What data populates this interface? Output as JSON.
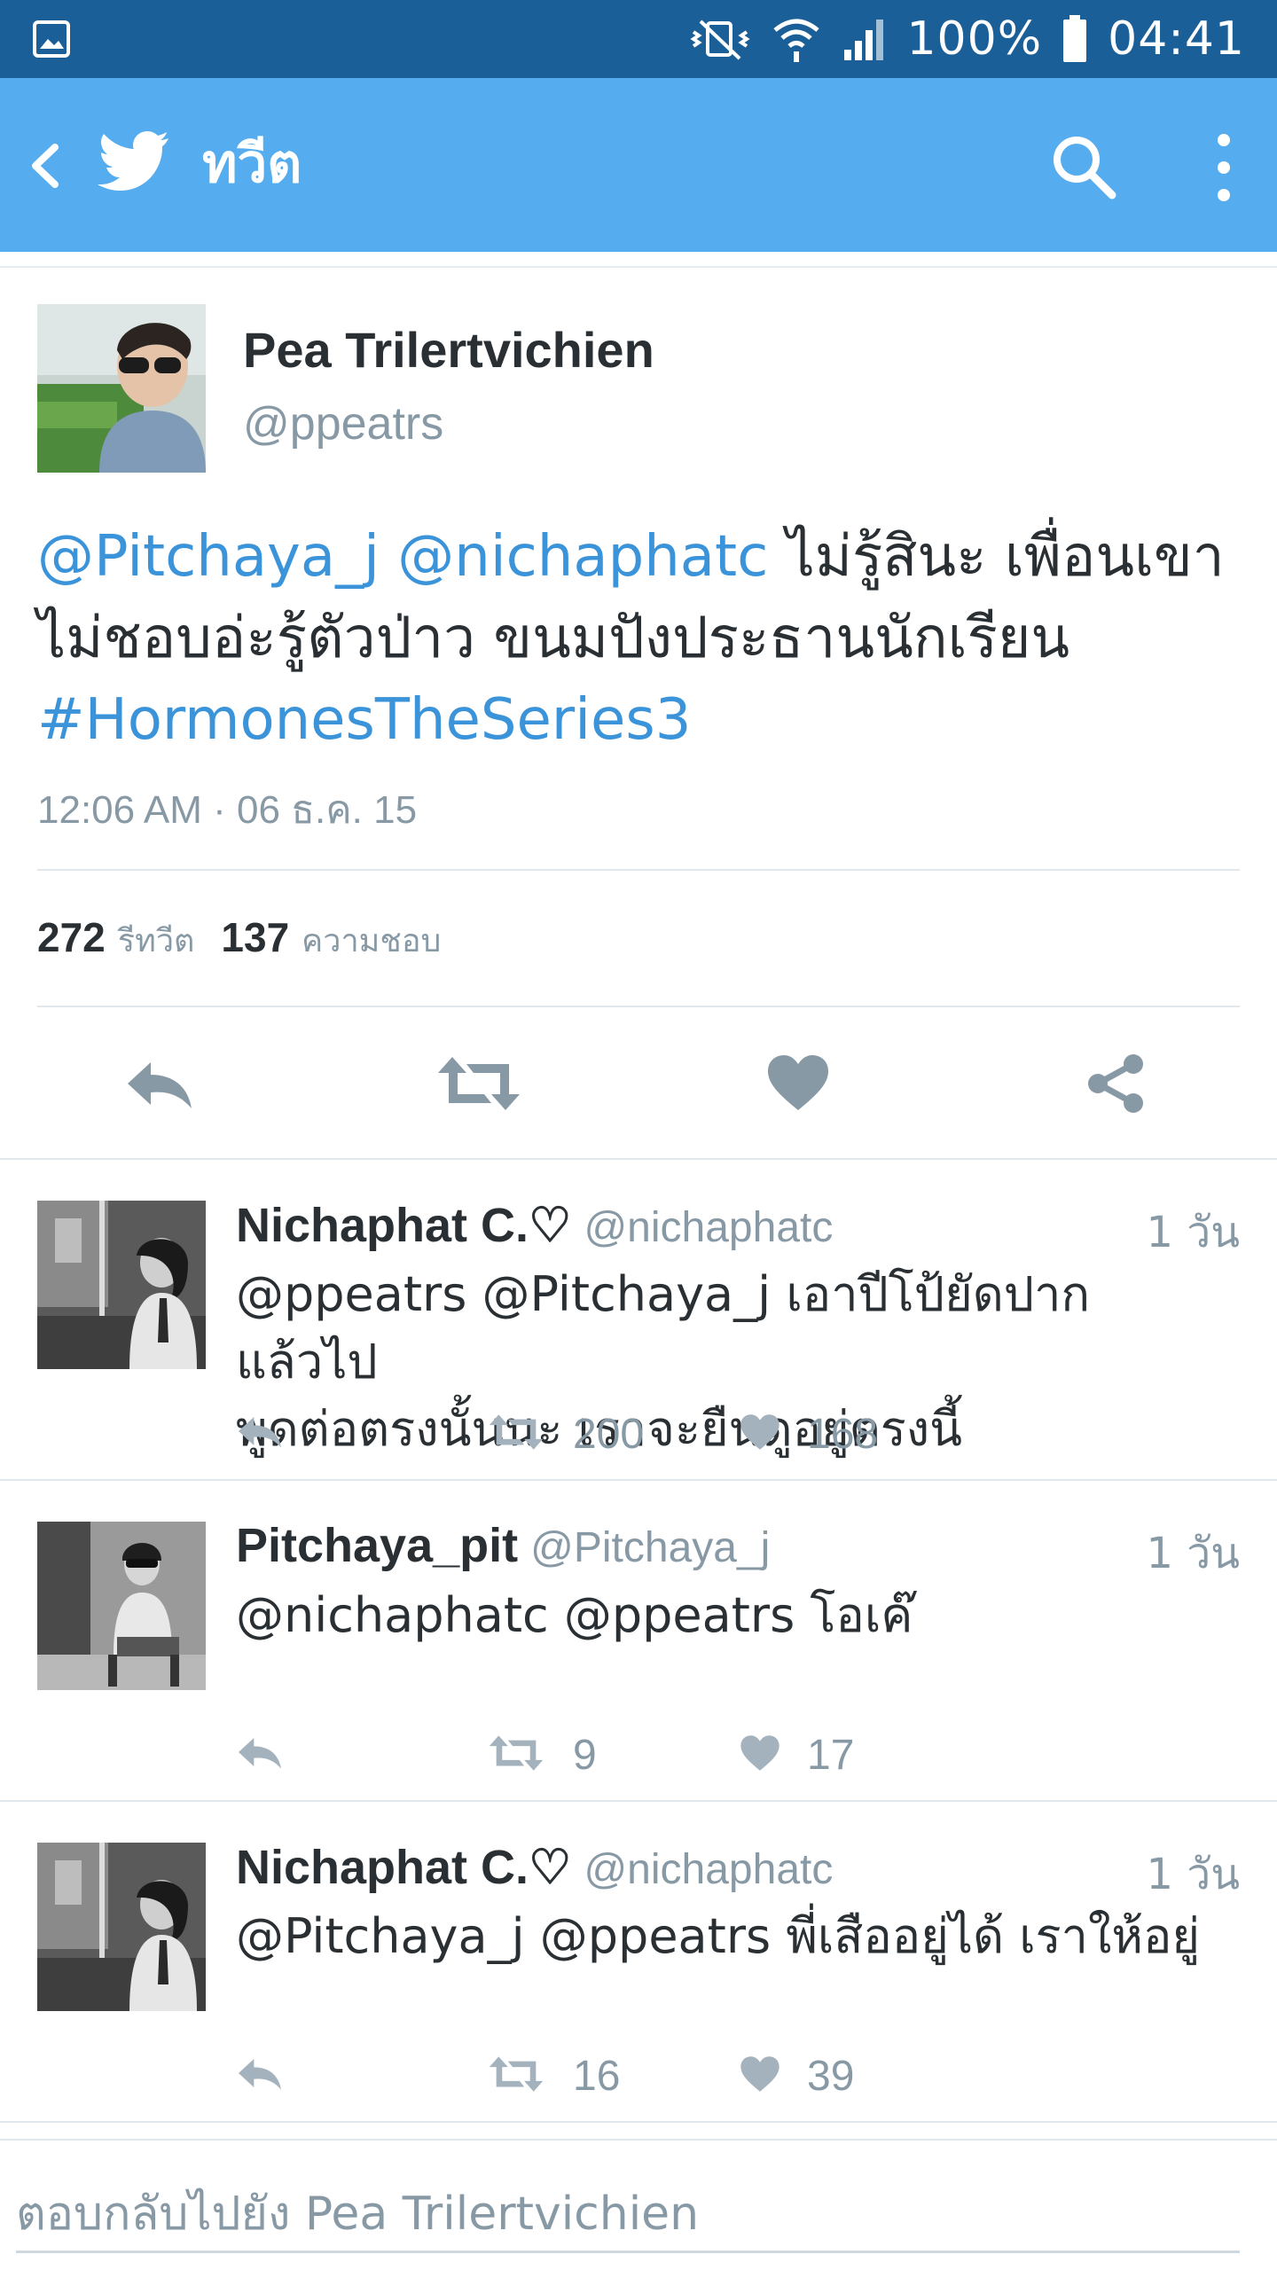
{
  "status_bar": {
    "battery": "100%",
    "time": "04:41"
  },
  "app_bar": {
    "title": "ทวีต"
  },
  "tweet": {
    "author_name": "Pea Trilertvichien",
    "author_handle": "@ppeatrs",
    "mention1": "@Pitchaya_j",
    "mention2": "@nichaphatc",
    "text1": "ไม่รู้สินะ เพื่อนเขา",
    "text2": "ไม่ชอบอ่ะรู้ตัวป่าว ขนมปังประธานนักเรียน",
    "hashtag": "#HormonesTheSeries3",
    "timestamp": "12:06 AM · 06 ธ.ค. 15",
    "retweet_count": "272",
    "retweet_label": "รีทวีต",
    "like_count": "137",
    "like_label": "ความชอบ"
  },
  "replies": [
    {
      "name": "Nichaphat C.♡",
      "handle": "@nichaphatc",
      "time": "1 วัน",
      "line1": "@ppeatrs @Pitchaya_j เอาปีโป้ยัดปาก แล้วไป",
      "line2": "พูดต่อตรงนั้นนะ เราจะยืนดูอยู่ตรงนี้",
      "retweets": "200",
      "likes": "168"
    },
    {
      "name": "Pitchaya_pit",
      "handle": "@Pitchaya_j",
      "time": "1 วัน",
      "line1": "@nichaphatc @ppeatrs โอเค๊",
      "line2": "",
      "retweets": "9",
      "likes": "17"
    },
    {
      "name": "Nichaphat C.♡",
      "handle": "@nichaphatc",
      "time": "1 วัน",
      "line1": "@Pitchaya_j @ppeatrs พี่เสืออยู่ได้ เราให้อยู่",
      "line2": "",
      "retweets": "16",
      "likes": "39"
    }
  ],
  "reply_box": {
    "placeholder": "ตอบกลับไปยัง Pea Trilertvichien"
  },
  "colors": {
    "status_bar": "#1b5f98",
    "app_bar": "#55acee",
    "link": "#3b94d9",
    "muted": "#8899a6",
    "icon": "#8899a6"
  }
}
